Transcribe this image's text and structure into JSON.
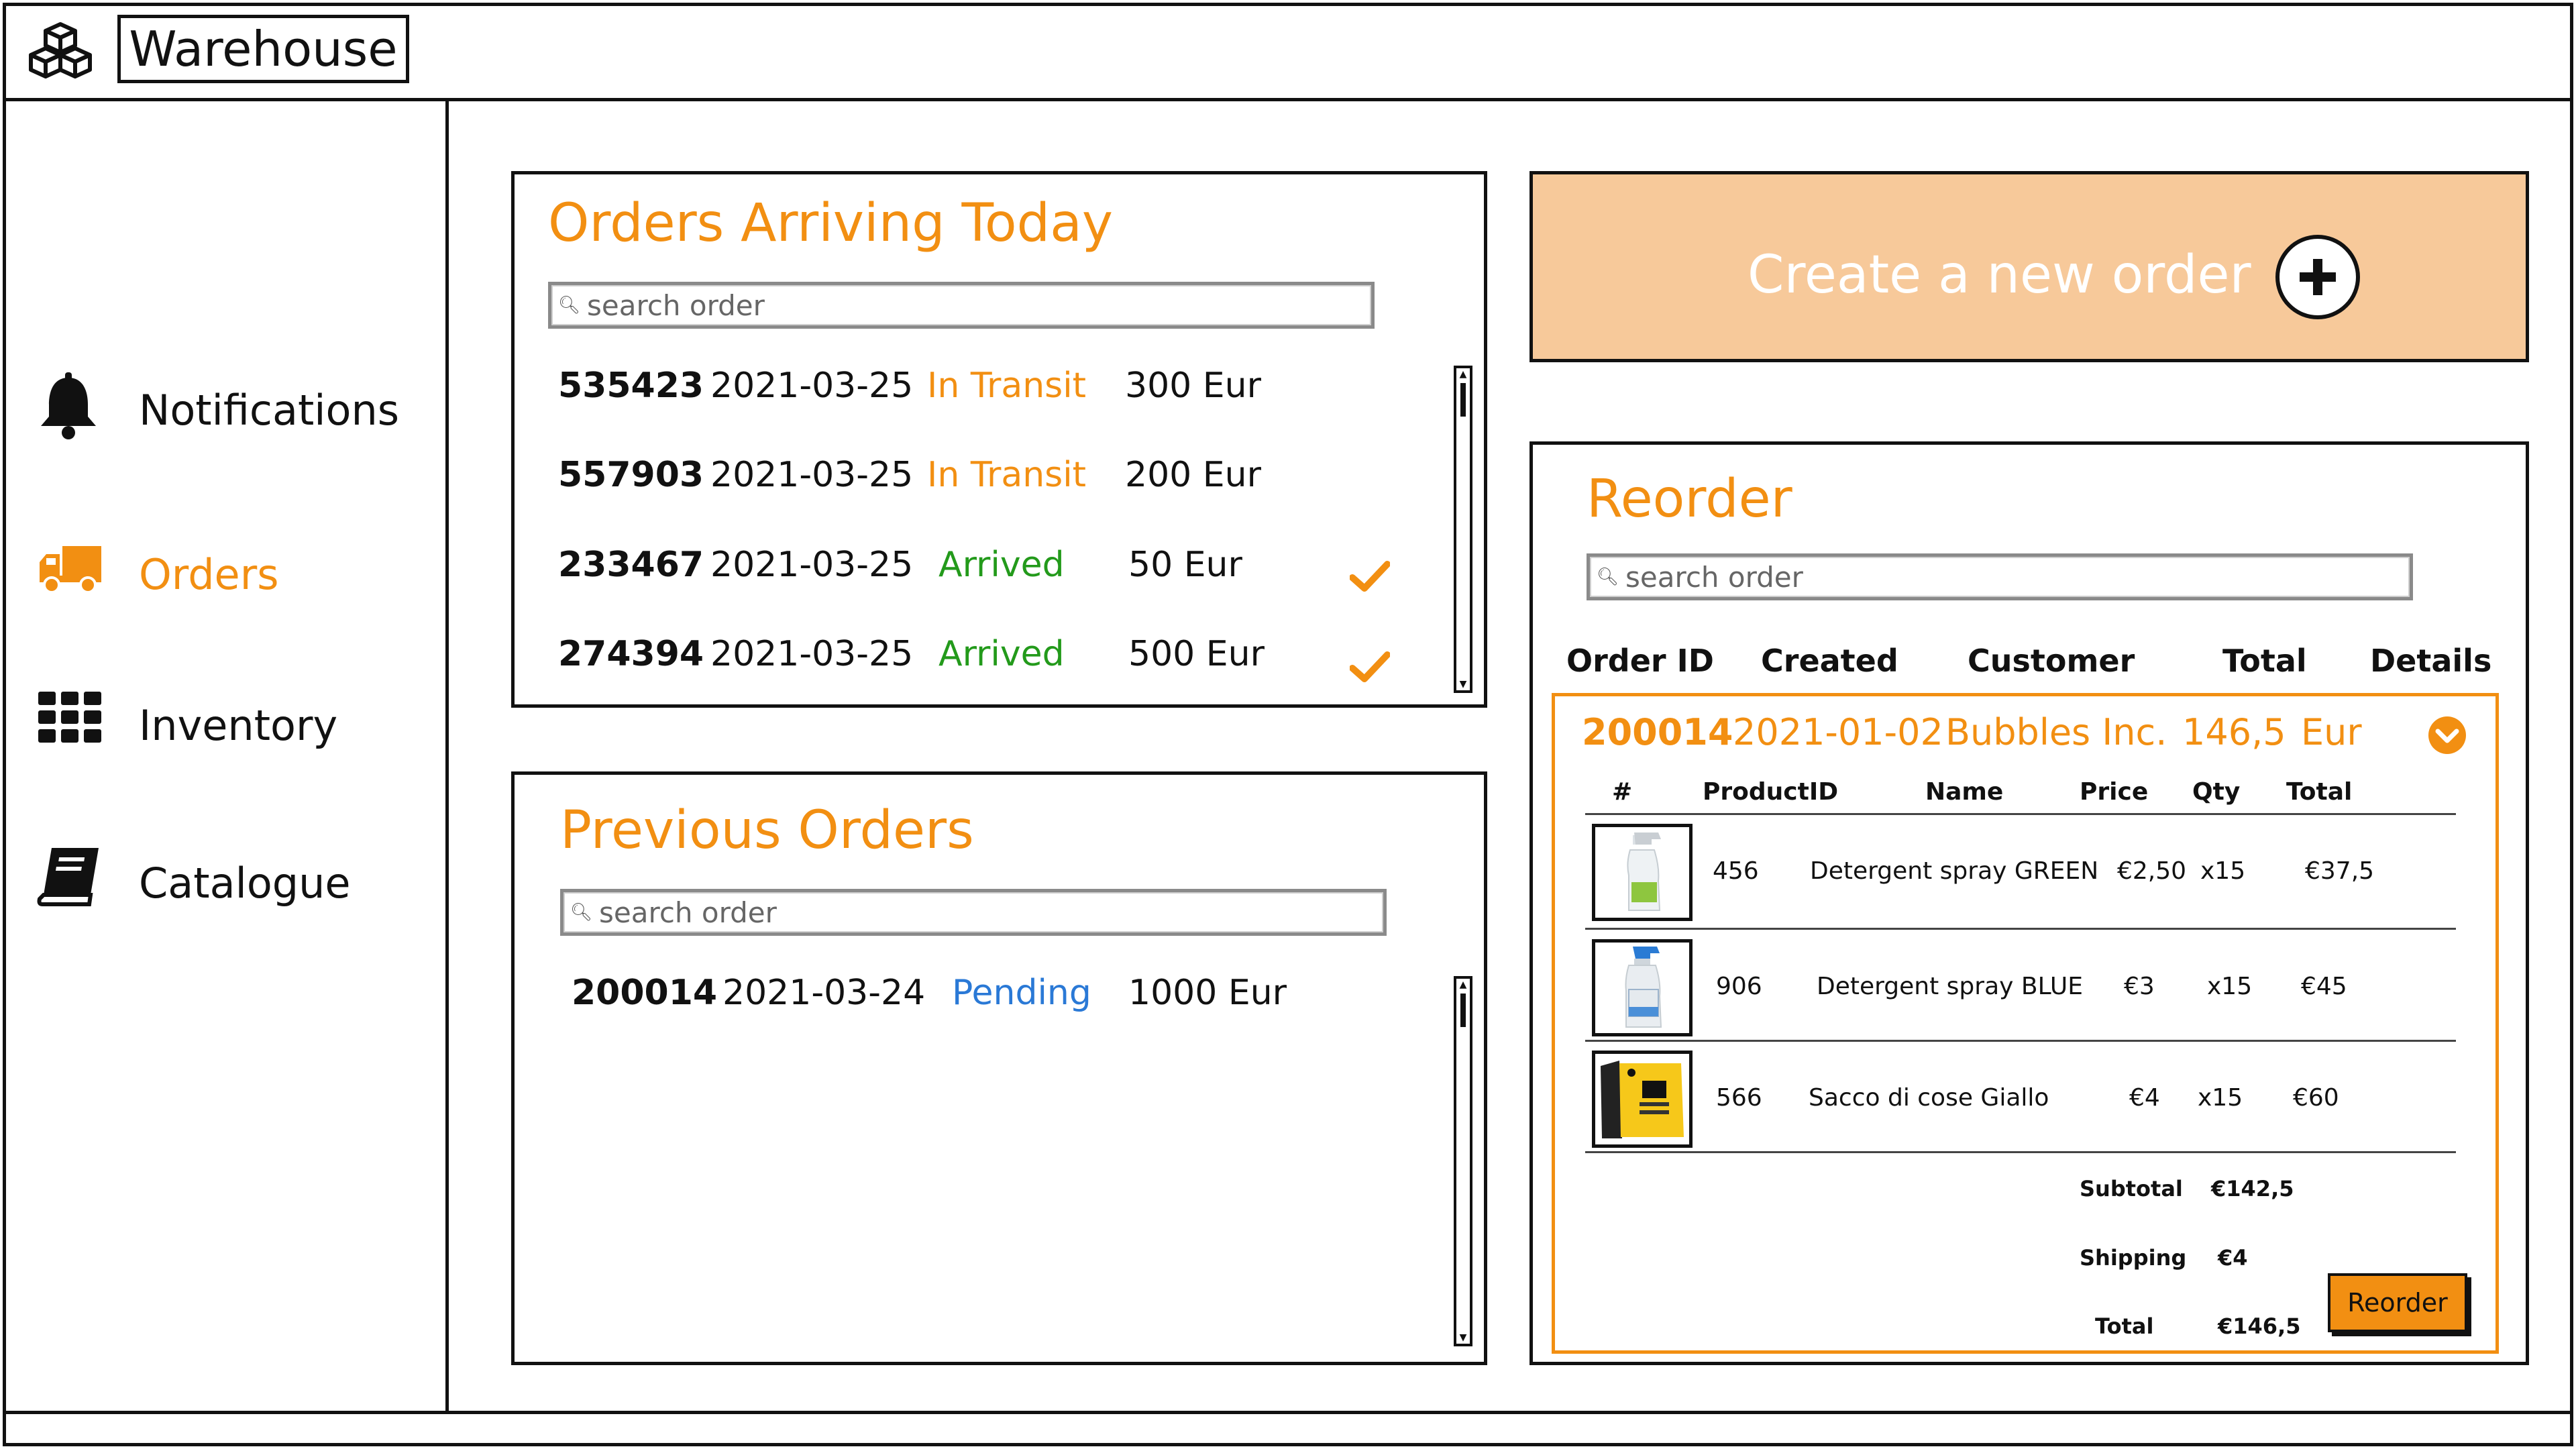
{
  "app": {
    "title": "Warehouse",
    "logo_icon": "boxes-icon"
  },
  "sidebar": {
    "items": [
      {
        "label": "Notifications",
        "icon": "bell-icon",
        "active": false
      },
      {
        "label": "Orders",
        "icon": "truck-icon",
        "active": true
      },
      {
        "label": "Inventory",
        "icon": "grid-icon",
        "active": false
      },
      {
        "label": "Catalogue",
        "icon": "book-icon",
        "active": false
      }
    ]
  },
  "arriving": {
    "title": "Orders Arriving Today",
    "search_placeholder": "search order",
    "rows": [
      {
        "id": "535423",
        "date": "2021-03-25",
        "status": "In Transit",
        "amount": "300 Eur",
        "checked": false
      },
      {
        "id": "557903",
        "date": "2021-03-25",
        "status": "In Transit",
        "amount": "200 Eur",
        "checked": false
      },
      {
        "id": "233467",
        "date": "2021-03-25",
        "status": "Arrived",
        "amount": "50 Eur",
        "checked": true
      },
      {
        "id": "274394",
        "date": "2021-03-25",
        "status": "Arrived",
        "amount": "500 Eur",
        "checked": true
      }
    ]
  },
  "previous": {
    "title": "Previous Orders",
    "search_placeholder": "search order",
    "rows": [
      {
        "id": "200014",
        "date": "2021-03-24",
        "status": "Pending",
        "amount": "1000 Eur"
      }
    ]
  },
  "create": {
    "label": "Create a new order",
    "icon": "plus-circle-icon"
  },
  "reorder": {
    "title": "Reorder",
    "search_placeholder": "search order",
    "columns": [
      "Order ID",
      "Created",
      "Customer",
      "Total",
      "Details"
    ],
    "order": {
      "id": "200014",
      "created": "2021-01-02",
      "customer": "Bubbles Inc.",
      "total": "146,5",
      "currency": "Eur",
      "item_columns": [
        "#",
        "ProductID",
        "Name",
        "Price",
        "Qty",
        "Total"
      ],
      "items": [
        {
          "product_id": "456",
          "name": "Detergent spray GREEN",
          "price": "€2,50",
          "qty": "x15",
          "total": "€37,5",
          "image": "green-spray-bottle"
        },
        {
          "product_id": "906",
          "name": "Detergent spray BLUE",
          "price": "€3",
          "qty": "x15",
          "total": "€45",
          "image": "blue-spray-bottle"
        },
        {
          "product_id": "566",
          "name": "Sacco di cose Giallo",
          "price": "€4",
          "qty": "x15",
          "total": "€60",
          "image": "yellow-bag"
        }
      ],
      "subtotal_label": "Subtotal",
      "subtotal": "€142,5",
      "shipping_label": "Shipping",
      "shipping": "€4",
      "total_label": "Total",
      "grand_total": "€146,5",
      "reorder_button": "Reorder"
    }
  },
  "colors": {
    "accent": "#f28f12",
    "accent_soft": "#f7c99a",
    "arrived": "#239a1b",
    "pending": "#2a79d6"
  }
}
